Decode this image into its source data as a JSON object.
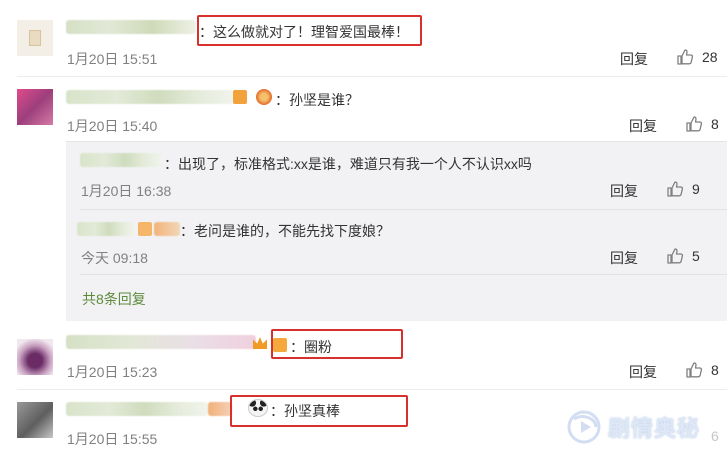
{
  "comments": [
    {
      "text": "：这么做就对了！理智爱国最棒！",
      "time": "1月20日 15:51",
      "reply_label": "回复",
      "likes": "28"
    },
    {
      "text": "：孙坚是谁？",
      "time": "1月20日 15:40",
      "reply_label": "回复",
      "likes": "8",
      "sub_replies": [
        {
          "text": "：出现了，标准格式:xx是谁，难道只有我一个人不认识xx吗",
          "time": "1月20日 16:38",
          "reply_label": "回复",
          "likes": "9"
        },
        {
          "text": "：老问是谁的，不能先找下度娘？",
          "time": "今天 09:18",
          "reply_label": "回复",
          "likes": "5"
        }
      ],
      "more_replies": "共8条回复"
    },
    {
      "text": "：圈粉",
      "time": "1月20日 15:23",
      "reply_label": "回复",
      "likes": "8"
    },
    {
      "text": "：孙坚真棒",
      "time": "1月20日 15:55",
      "reply_label": "回复",
      "likes": "6"
    }
  ],
  "watermark": "剧情奥秘",
  "colors": {
    "highlight_box": "#d8302d",
    "link_green": "#5e8a3a",
    "meta_gray": "#808080"
  }
}
